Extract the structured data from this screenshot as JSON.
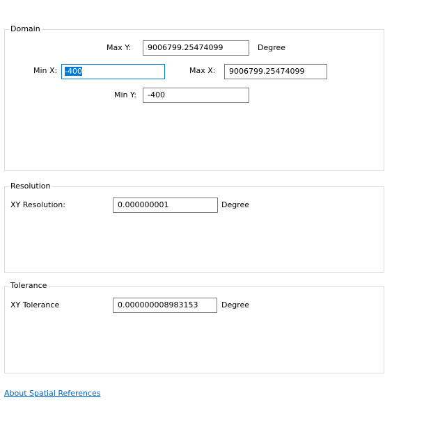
{
  "domain": {
    "legend": "Domain",
    "max_y_label": "Max Y:",
    "max_y_value": "9006799.25474099",
    "max_y_unit": "Degree",
    "min_x_label": "Min X:",
    "min_x_value": "-400",
    "max_x_label": "Max X:",
    "max_x_value": "9006799.25474099",
    "min_y_label": "Min Y:",
    "min_y_value": "-400"
  },
  "resolution": {
    "legend": "Resolution",
    "xy_label": "XY Resolution:",
    "xy_value": "0.000000001",
    "xy_unit": "Degree"
  },
  "tolerance": {
    "legend": "Tolerance",
    "xy_label": "XY Tolerance",
    "xy_value": "0.000000008983153",
    "xy_unit": "Degree"
  },
  "footer": {
    "about_link": "About Spatial References"
  },
  "colors": {
    "link": "#0066cc",
    "selection": "#0078d7",
    "focus_border": "#0078d7",
    "group_border": "#dcdcdc"
  }
}
